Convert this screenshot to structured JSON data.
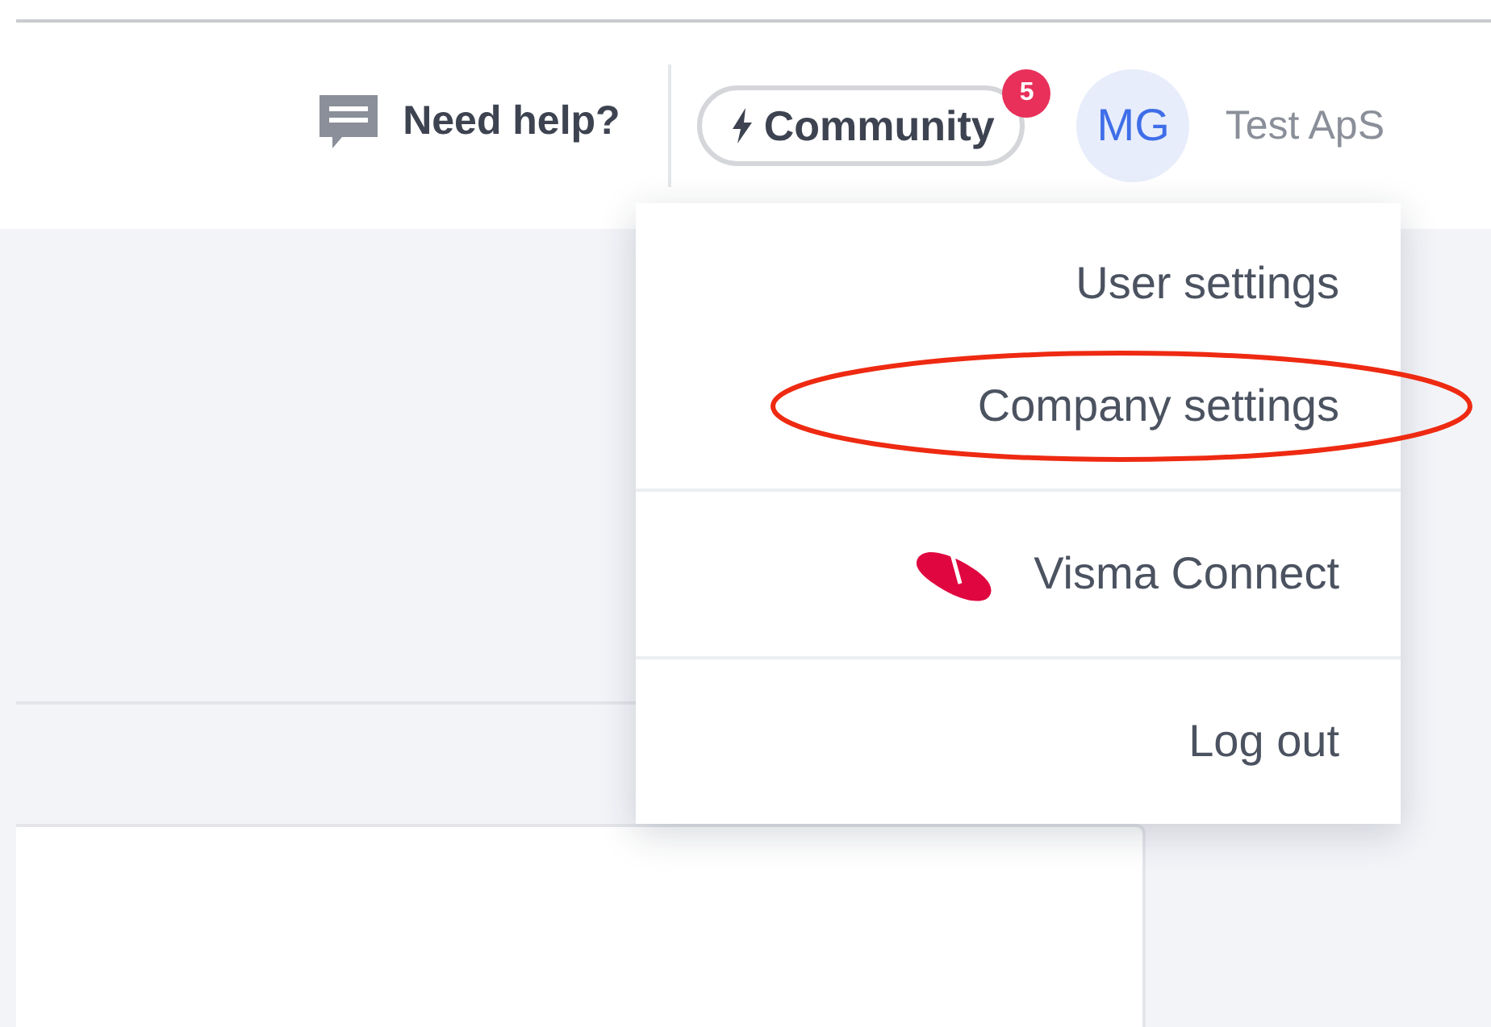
{
  "header": {
    "help": {
      "label": "Need help?"
    },
    "community": {
      "label": "Community",
      "badge": "5"
    },
    "user": {
      "initials": "MG",
      "company": "Test ApS"
    }
  },
  "user_menu": {
    "groups": [
      {
        "items": [
          {
            "kind": "text",
            "label": "User settings",
            "highlighted": false
          },
          {
            "kind": "text",
            "label": "Company settings",
            "highlighted": true
          }
        ]
      },
      {
        "items": [
          {
            "kind": "brand",
            "label": "Visma Connect",
            "highlighted": false
          }
        ]
      },
      {
        "items": [
          {
            "kind": "text",
            "label": "Log out",
            "highlighted": false
          }
        ]
      }
    ]
  }
}
